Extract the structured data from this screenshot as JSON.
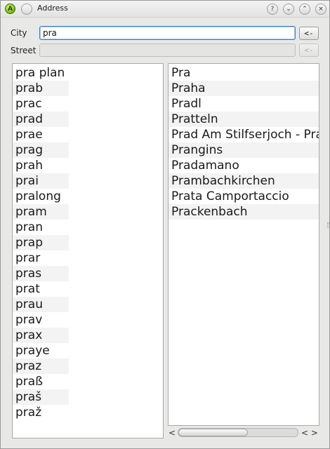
{
  "window": {
    "title": "Address",
    "app_icon_letter": "A",
    "buttons": [
      "?",
      "⌄",
      "⌃",
      "×"
    ]
  },
  "form": {
    "city_label": "City",
    "city_value": "pra",
    "city_button": "<-",
    "street_label": "Street",
    "street_value": "",
    "street_button": "<-"
  },
  "left_list": {
    "items": [
      "pra plan",
      "prab",
      "prac",
      "prad",
      "prae",
      "prag",
      "prah",
      "prai",
      "pralong",
      "pram",
      "pran",
      "prap",
      "prar",
      "pras",
      "prat",
      "prau",
      "prav",
      "prax",
      "praye",
      "praz",
      "praß",
      "praš",
      "praž"
    ]
  },
  "right_list": {
    "items": [
      "Pra",
      "Praha",
      "Pradl",
      "Pratteln",
      "Prad Am Stilfserjoch - Prato allo Stelvio",
      "Prangins",
      "Pradamano",
      "Prambachkirchen",
      "Prata Camportaccio",
      "Prackenbach"
    ]
  },
  "scrollbar": {
    "left_arrow": "<",
    "right_arrows": "< >",
    "thumb_fraction": 0.58
  }
}
